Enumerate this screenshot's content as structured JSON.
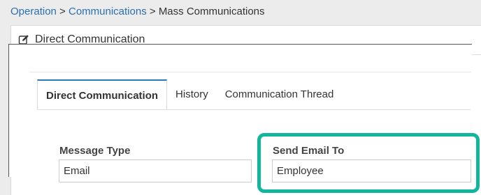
{
  "breadcrumb": {
    "items": [
      "Operation",
      "Communications",
      "Mass Communications"
    ],
    "separator": ">"
  },
  "panel": {
    "title": "Direct Communication",
    "title_icon": "edit-icon"
  },
  "tabs": [
    {
      "label": "Direct Communication",
      "active": true
    },
    {
      "label": "History",
      "active": false
    },
    {
      "label": "Communication Thread",
      "active": false
    }
  ],
  "form": {
    "message_type": {
      "label": "Message Type",
      "value": "Email"
    },
    "send_email_to": {
      "label": "Send Email To",
      "value": "Employee"
    }
  },
  "colors": {
    "link": "#2a6fb0",
    "active_tab_accent": "#2a7ab8",
    "highlight": "#13b59c"
  }
}
